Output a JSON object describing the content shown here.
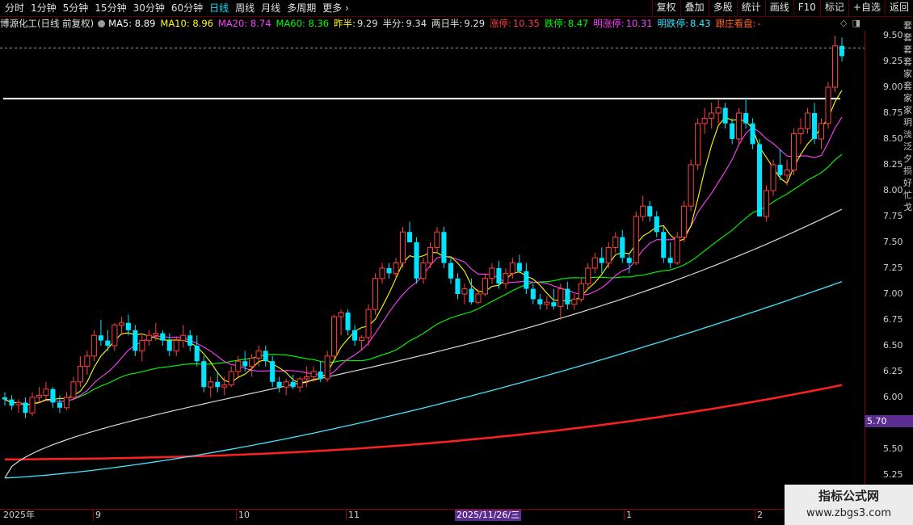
{
  "toolbar": {
    "periods": [
      "分时",
      "1分钟",
      "5分钟",
      "15分钟",
      "30分钟",
      "60分钟",
      "日线",
      "周线",
      "月线",
      "多周期",
      "更多"
    ],
    "active_period": "日线",
    "more_chevron": "›",
    "right_buttons": [
      "复权",
      "叠加",
      "多股",
      "统计",
      "画线",
      "F10",
      "标记",
      "+自选",
      "返回"
    ]
  },
  "infobar": {
    "stock": "博源化工(日线 前复权)",
    "ma5": "MA5: 8.89",
    "ma10": "MA10: 8.96",
    "ma20": "MA20: 8.74",
    "ma60": "MA60: 8.36",
    "prev_half_label": "昨半:",
    "prev_half_value": "9.29",
    "half_label": "半分:",
    "half_value": "9.34",
    "two_day_label": "两日半:",
    "two_day_value": "9.29",
    "zt_label": "涨停:",
    "zt_value": "10.35",
    "dt_label": "跌停:",
    "dt_value": "8.47",
    "mzt_label": "明涨停:",
    "mzt_value": "10.31",
    "mdt_label": "明跌停:",
    "mdt_value": "8.43",
    "zhuang": "跟庄看盘:",
    "zhuang_value": "-"
  },
  "colors": {
    "up": "#ff4040",
    "down": "#00e5ff",
    "ma5": "#ffffff",
    "ma10": "#ffff00",
    "ma20": "#ff40ff",
    "ma60": "#00ff00",
    "ma120": "#d8d8d8",
    "ma250": "#44e5ff",
    "long_red": "#ff2020",
    "accent": "#5b2d91"
  },
  "yaxis": {
    "ticks": [
      "9.50",
      "9.25",
      "9.00",
      "8.75",
      "8.50",
      "8.25",
      "8.00",
      "7.75",
      "7.50",
      "7.25",
      "7.00",
      "6.75",
      "6.50",
      "6.25",
      "6.00",
      "5.70",
      "5.50",
      "5.25"
    ],
    "current_price_tag": "5.70"
  },
  "time_axis": {
    "labels": [
      "2025年",
      "9",
      "10",
      "11",
      "2025/11/26/三",
      "1",
      "2"
    ]
  },
  "side_strip": "套套套套家套家家玥淡泛夕损好忙戈",
  "watermark": {
    "line1": "指标公式网",
    "line2": "www.zbgs3.com"
  },
  "chart_data": {
    "type": "candlestick",
    "title": "",
    "ylim": [
      5.25,
      9.5
    ],
    "resistance_line": 8.89,
    "candles": [
      [
        6.0,
        6.05,
        5.92,
        5.98
      ],
      [
        5.98,
        6.02,
        5.88,
        5.92
      ],
      [
        5.93,
        5.98,
        5.85,
        5.95
      ],
      [
        5.95,
        6.0,
        5.8,
        5.85
      ],
      [
        5.85,
        6.05,
        5.82,
        6.0
      ],
      [
        6.0,
        6.1,
        5.95,
        6.02
      ],
      [
        6.02,
        6.15,
        5.98,
        6.08
      ],
      [
        6.08,
        6.1,
        5.9,
        5.95
      ],
      [
        5.95,
        6.02,
        5.85,
        5.9
      ],
      [
        5.9,
        6.05,
        5.88,
        6.0
      ],
      [
        6.0,
        6.2,
        5.98,
        6.15
      ],
      [
        6.15,
        6.4,
        6.1,
        6.3
      ],
      [
        6.3,
        6.45,
        6.22,
        6.4
      ],
      [
        6.4,
        6.65,
        6.35,
        6.6
      ],
      [
        6.6,
        6.75,
        6.5,
        6.55
      ],
      [
        6.55,
        6.65,
        6.45,
        6.5
      ],
      [
        6.5,
        6.72,
        6.45,
        6.7
      ],
      [
        6.7,
        6.78,
        6.6,
        6.72
      ],
      [
        6.72,
        6.8,
        6.6,
        6.65
      ],
      [
        6.65,
        6.7,
        6.4,
        6.45
      ],
      [
        6.45,
        6.6,
        6.35,
        6.55
      ],
      [
        6.55,
        6.65,
        6.5,
        6.6
      ],
      [
        6.6,
        6.72,
        6.55,
        6.62
      ],
      [
        6.62,
        6.65,
        6.5,
        6.55
      ],
      [
        6.55,
        6.62,
        6.4,
        6.45
      ],
      [
        6.45,
        6.58,
        6.4,
        6.55
      ],
      [
        6.55,
        6.7,
        6.48,
        6.6
      ],
      [
        6.6,
        6.65,
        6.45,
        6.5
      ],
      [
        6.5,
        6.6,
        6.3,
        6.35
      ],
      [
        6.35,
        6.4,
        6.05,
        6.1
      ],
      [
        6.1,
        6.2,
        6.0,
        6.15
      ],
      [
        6.15,
        6.25,
        6.05,
        6.1
      ],
      [
        6.1,
        6.2,
        6.02,
        6.12
      ],
      [
        6.12,
        6.3,
        6.1,
        6.25
      ],
      [
        6.25,
        6.4,
        6.2,
        6.35
      ],
      [
        6.35,
        6.45,
        6.25,
        6.3
      ],
      [
        6.3,
        6.42,
        6.2,
        6.38
      ],
      [
        6.38,
        6.5,
        6.3,
        6.45
      ],
      [
        6.45,
        6.5,
        6.3,
        6.35
      ],
      [
        6.35,
        6.4,
        6.1,
        6.15
      ],
      [
        6.15,
        6.2,
        6.05,
        6.1
      ],
      [
        6.1,
        6.18,
        6.02,
        6.15
      ],
      [
        6.15,
        6.22,
        6.08,
        6.1
      ],
      [
        6.1,
        6.2,
        6.05,
        6.18
      ],
      [
        6.18,
        6.3,
        6.1,
        6.2
      ],
      [
        6.2,
        6.3,
        6.15,
        6.25
      ],
      [
        6.25,
        6.35,
        6.15,
        6.18
      ],
      [
        6.18,
        6.45,
        6.15,
        6.4
      ],
      [
        6.4,
        6.8,
        6.38,
        6.78
      ],
      [
        6.78,
        6.85,
        6.6,
        6.82
      ],
      [
        6.82,
        6.85,
        6.6,
        6.65
      ],
      [
        6.65,
        6.7,
        6.5,
        6.55
      ],
      [
        6.55,
        6.6,
        6.45,
        6.58
      ],
      [
        6.58,
        6.9,
        6.5,
        6.85
      ],
      [
        6.85,
        7.2,
        6.8,
        7.15
      ],
      [
        7.15,
        7.3,
        7.1,
        7.25
      ],
      [
        7.25,
        7.3,
        7.15,
        7.2
      ],
      [
        7.2,
        7.35,
        7.15,
        7.3
      ],
      [
        7.3,
        7.65,
        7.25,
        7.6
      ],
      [
        7.6,
        7.7,
        7.5,
        7.5
      ],
      [
        7.5,
        7.55,
        7.1,
        7.15
      ],
      [
        7.15,
        7.35,
        7.1,
        7.3
      ],
      [
        7.3,
        7.5,
        7.25,
        7.45
      ],
      [
        7.45,
        7.65,
        7.4,
        7.6
      ],
      [
        7.6,
        7.65,
        7.25,
        7.3
      ],
      [
        7.3,
        7.35,
        7.1,
        7.15
      ],
      [
        7.15,
        7.2,
        6.95,
        7.0
      ],
      [
        7.0,
        7.1,
        6.9,
        7.05
      ],
      [
        7.05,
        7.15,
        6.9,
        6.92
      ],
      [
        6.92,
        7.05,
        6.9,
        7.0
      ],
      [
        7.0,
        7.2,
        6.98,
        7.15
      ],
      [
        7.15,
        7.3,
        7.1,
        7.25
      ],
      [
        7.25,
        7.32,
        7.05,
        7.1
      ],
      [
        7.1,
        7.25,
        7.05,
        7.2
      ],
      [
        7.2,
        7.35,
        7.15,
        7.3
      ],
      [
        7.3,
        7.38,
        7.2,
        7.22
      ],
      [
        7.22,
        7.3,
        7.0,
        7.05
      ],
      [
        7.05,
        7.1,
        6.9,
        6.95
      ],
      [
        6.95,
        7.0,
        6.85,
        6.9
      ],
      [
        6.9,
        6.98,
        6.85,
        6.92
      ],
      [
        6.92,
        7.05,
        6.85,
        6.88
      ],
      [
        6.88,
        7.1,
        6.75,
        7.05
      ],
      [
        7.05,
        7.12,
        6.85,
        6.9
      ],
      [
        6.9,
        7.0,
        6.85,
        6.95
      ],
      [
        6.95,
        7.15,
        6.92,
        7.1
      ],
      [
        7.1,
        7.3,
        7.05,
        7.25
      ],
      [
        7.25,
        7.4,
        7.2,
        7.35
      ],
      [
        7.35,
        7.45,
        7.2,
        7.3
      ],
      [
        7.3,
        7.5,
        7.25,
        7.45
      ],
      [
        7.45,
        7.6,
        7.4,
        7.55
      ],
      [
        7.55,
        7.62,
        7.3,
        7.35
      ],
      [
        7.35,
        7.4,
        7.2,
        7.3
      ],
      [
        7.3,
        7.8,
        7.28,
        7.75
      ],
      [
        7.75,
        7.95,
        7.7,
        7.85
      ],
      [
        7.85,
        7.9,
        7.7,
        7.75
      ],
      [
        7.75,
        7.8,
        7.55,
        7.6
      ],
      [
        7.6,
        7.65,
        7.3,
        7.35
      ],
      [
        7.35,
        7.5,
        7.25,
        7.3
      ],
      [
        7.3,
        7.6,
        7.28,
        7.55
      ],
      [
        7.55,
        7.9,
        7.5,
        7.85
      ],
      [
        7.85,
        8.3,
        7.8,
        8.25
      ],
      [
        8.25,
        8.7,
        8.2,
        8.65
      ],
      [
        8.65,
        8.8,
        8.55,
        8.7
      ],
      [
        8.7,
        8.85,
        8.6,
        8.75
      ],
      [
        8.75,
        8.88,
        8.65,
        8.8
      ],
      [
        8.8,
        8.85,
        8.6,
        8.65
      ],
      [
        8.65,
        8.7,
        8.45,
        8.5
      ],
      [
        8.5,
        8.8,
        8.45,
        8.75
      ],
      [
        8.75,
        8.9,
        8.6,
        8.65
      ],
      [
        8.65,
        8.7,
        8.4,
        8.45
      ],
      [
        8.45,
        8.5,
        7.9,
        7.75
      ],
      [
        7.75,
        8.05,
        7.7,
        8.0
      ],
      [
        8.0,
        8.3,
        7.95,
        8.25
      ],
      [
        8.25,
        8.4,
        8.1,
        8.15
      ],
      [
        8.15,
        8.3,
        8.05,
        8.2
      ],
      [
        8.2,
        8.6,
        8.15,
        8.55
      ],
      [
        8.55,
        8.7,
        8.45,
        8.6
      ],
      [
        8.6,
        8.8,
        8.55,
        8.75
      ],
      [
        8.75,
        8.85,
        8.45,
        8.5
      ],
      [
        8.5,
        8.7,
        8.4,
        8.65
      ],
      [
        8.65,
        9.05,
        8.6,
        9.0
      ],
      [
        9.0,
        9.5,
        8.95,
        9.4
      ],
      [
        9.4,
        9.48,
        9.25,
        9.3
      ]
    ]
  }
}
